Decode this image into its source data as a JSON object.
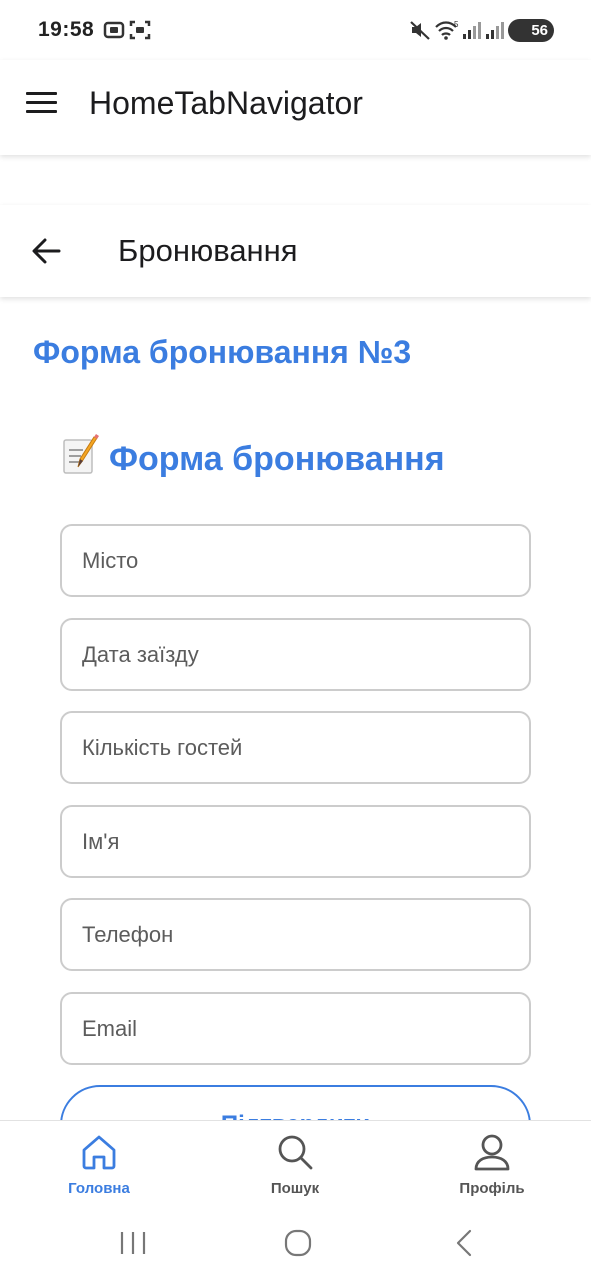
{
  "status_bar": {
    "time": "19:58",
    "battery": "56"
  },
  "app_bar": {
    "title": "HomeTabNavigator"
  },
  "stack_header": {
    "title": "Бронювання"
  },
  "form": {
    "main_title": "Форма бронювання №3",
    "sub_title": "Форма бронювання",
    "sub_title_emoji": "memo-icon",
    "fields": [
      {
        "placeholder": "Місто",
        "value": ""
      },
      {
        "placeholder": "Дата заїзду",
        "value": ""
      },
      {
        "placeholder": "Кількість гостей",
        "value": ""
      },
      {
        "placeholder": "Ім'я",
        "value": ""
      },
      {
        "placeholder": "Телефон",
        "value": ""
      },
      {
        "placeholder": "Email",
        "value": ""
      }
    ],
    "submit_label": "Підтвердити"
  },
  "tabs": [
    {
      "label": "Головна",
      "icon": "home-icon",
      "active": true
    },
    {
      "label": "Пошук",
      "icon": "search-icon",
      "active": false
    },
    {
      "label": "Профіль",
      "icon": "person-icon",
      "active": false
    }
  ],
  "colors": {
    "accent": "#3b7de0",
    "text_dark": "#1c1c1e",
    "inactive_tab": "#555555",
    "input_border": "#cccccc"
  }
}
